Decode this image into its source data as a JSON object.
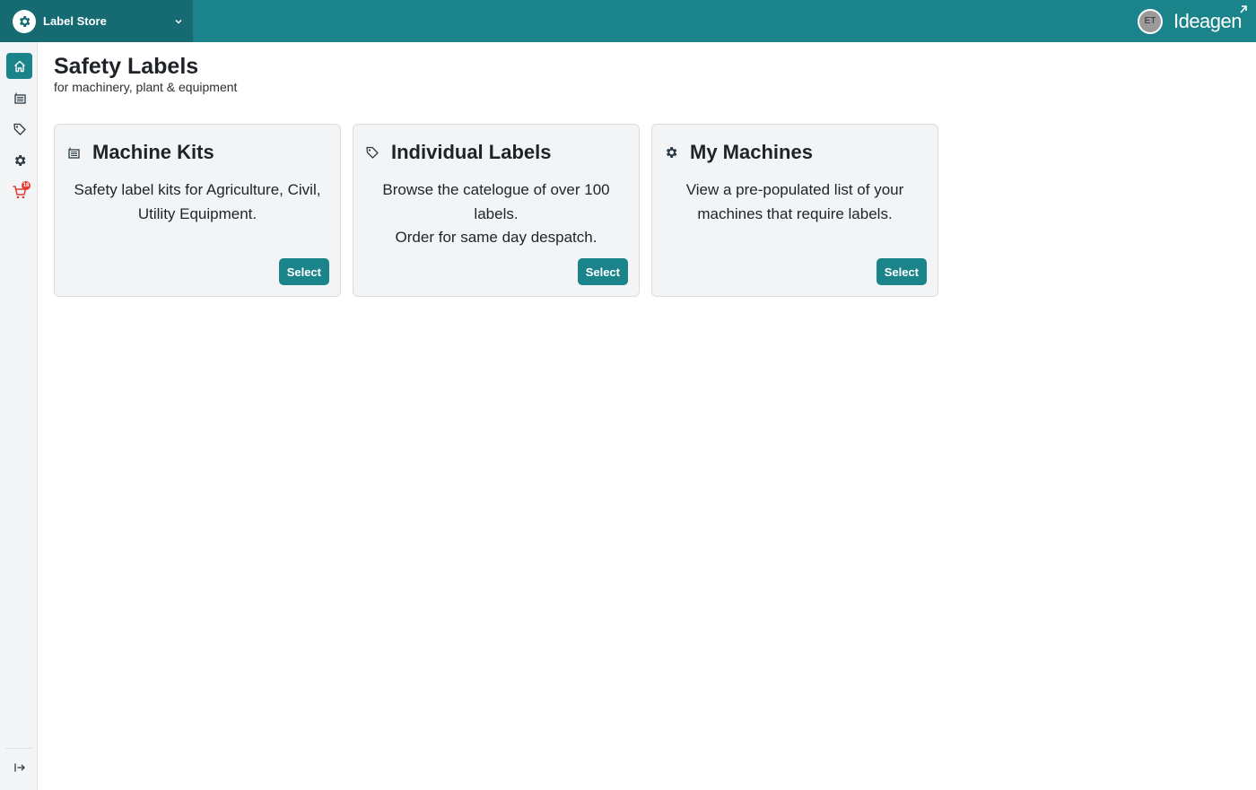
{
  "header": {
    "app_name": "Label Store",
    "user_initials": "ET",
    "brand": "Ideagen"
  },
  "sidebar": {
    "items": [
      {
        "name": "home",
        "icon": "home-icon",
        "active": true
      },
      {
        "name": "machine-kits",
        "icon": "list-icon",
        "active": false
      },
      {
        "name": "labels",
        "icon": "tag-icon",
        "active": false
      },
      {
        "name": "machines",
        "icon": "gear-icon",
        "active": false
      },
      {
        "name": "cart",
        "icon": "cart-icon",
        "active": false,
        "badge": "18"
      }
    ],
    "footer_icon": "expand-sidebar-icon"
  },
  "page": {
    "title": "Safety Labels",
    "subtitle": "for machinery, plant & equipment"
  },
  "cards": [
    {
      "icon": "list-icon",
      "title": "Machine Kits",
      "lines": [
        "Safety label kits for Agriculture, Civil, Utility Equipment."
      ],
      "button": "Select"
    },
    {
      "icon": "tag-icon",
      "title": "Individual Labels",
      "lines": [
        "Browse the catelogue of over 100 labels.",
        "Order for same day despatch."
      ],
      "button": "Select"
    },
    {
      "icon": "gear-icon",
      "title": "My Machines",
      "lines": [
        "View a pre-populated list of your machines that require labels."
      ],
      "button": "Select"
    }
  ],
  "colors": {
    "primary": "#1b848b",
    "primary_dark": "#166a71",
    "badge": "#e53935"
  }
}
